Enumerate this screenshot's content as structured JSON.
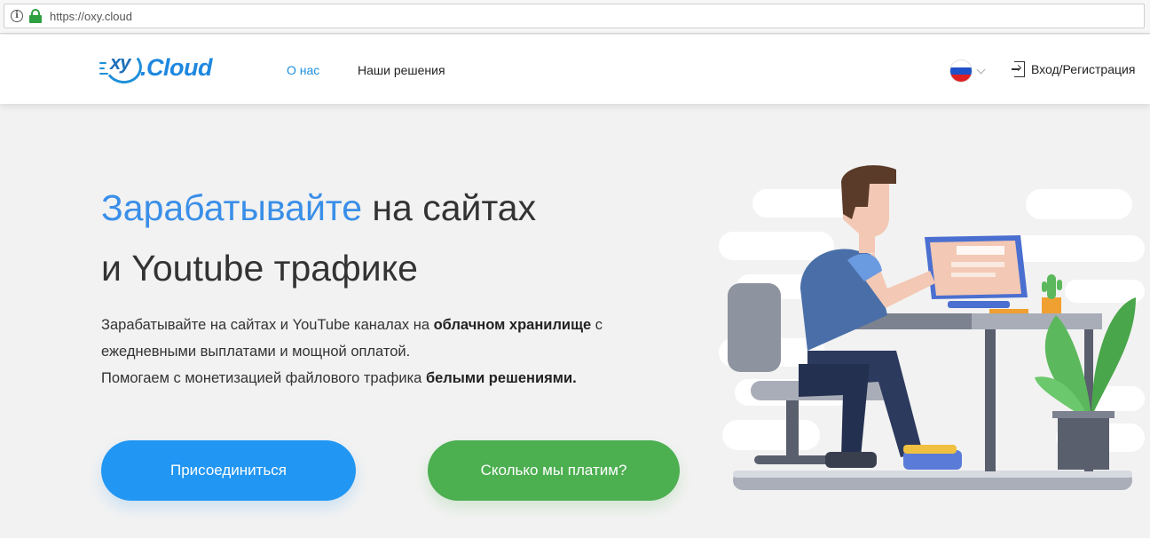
{
  "browser": {
    "url": "https://oxy.cloud"
  },
  "header": {
    "logo_mark": "xy",
    "logo_word": ".Cloud",
    "nav": {
      "about": "О нас",
      "solutions": "Наши решения"
    },
    "login": "Вход/Регистрация"
  },
  "hero": {
    "title_accent": "Зарабатывайте",
    "title_rest": " на сайтах",
    "title_line2": "и Youtube трафике",
    "desc": {
      "p1_start": "Зарабатывайте на сайтах и YouTube каналах на ",
      "p1_bold": "облачном хранилище",
      "p1_end": " с",
      "p2": "ежедневными выплатами и мощной оплатой.",
      "p3_start": "Помогаем с монетизацией файлового трафика ",
      "p3_bold": "белыми решениями."
    },
    "btn_join": "Присоединиться",
    "btn_pay": "Сколько мы платим?"
  },
  "colors": {
    "accent_blue": "#3a8fe8",
    "button_blue": "#2196f3",
    "button_green": "#4caf50"
  }
}
